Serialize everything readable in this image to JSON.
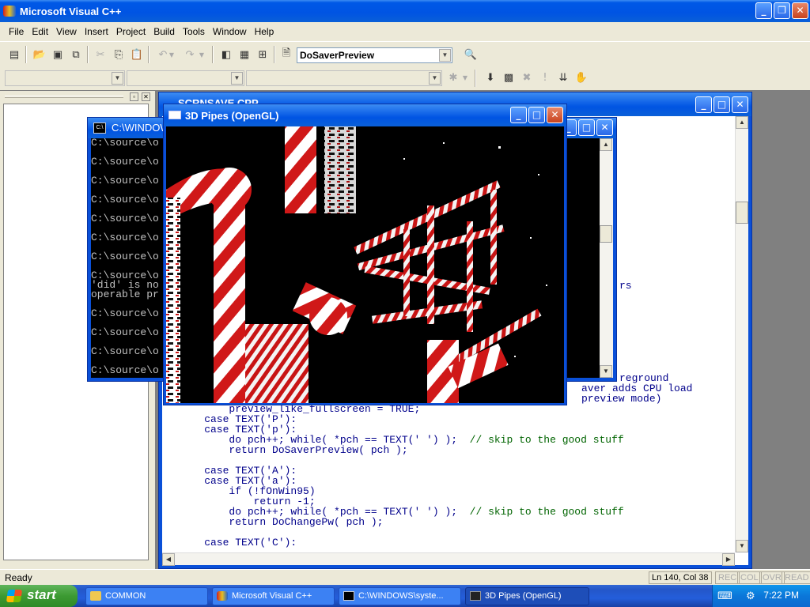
{
  "app": {
    "title": "Microsoft Visual C++",
    "menu": [
      "File",
      "Edit",
      "View",
      "Insert",
      "Project",
      "Build",
      "Tools",
      "Window",
      "Help"
    ],
    "toolbar": {
      "find_combo_value": "DoSaverPreview"
    }
  },
  "console_window": {
    "title": "C:\\WINDOW",
    "lines": [
      "C:\\source\\o",
      "",
      "C:\\source\\o",
      "",
      "C:\\source\\o",
      "",
      "C:\\source\\o",
      "",
      "C:\\source\\o",
      "",
      "C:\\source\\o",
      "",
      "C:\\source\\o",
      "",
      "C:\\source\\o",
      "'did' is no",
      "operable pr",
      "",
      "C:\\source\\o",
      "",
      "C:\\source\\o",
      "",
      "C:\\source\\o",
      "",
      "C:\\source\\o"
    ]
  },
  "pipes_window": {
    "title": "3D Pipes (OpenGL)"
  },
  "editor": {
    "title": "SCRNSAVE.CPP",
    "right_fragments": [
      "rs",
      "reground",
      "aver adds CPU load",
      "preview mode)"
    ],
    "code": [
      {
        "text": "        preview_like_fullscreen = TRUE;",
        "comment": ""
      },
      {
        "text": "    case TEXT('P'):",
        "comment": ""
      },
      {
        "text": "    case TEXT('p'):",
        "comment": ""
      },
      {
        "text": "        do pch++; while( *pch == TEXT(' ') );  ",
        "comment": "// skip to the good stuff"
      },
      {
        "text": "        return DoSaverPreview( pch );",
        "comment": ""
      },
      {
        "text": "",
        "comment": ""
      },
      {
        "text": "    case TEXT('A'):",
        "comment": ""
      },
      {
        "text": "    case TEXT('a'):",
        "comment": ""
      },
      {
        "text": "        if (!fOnWin95)",
        "comment": ""
      },
      {
        "text": "            return -1;",
        "comment": ""
      },
      {
        "text": "        do pch++; while( *pch == TEXT(' ') );  ",
        "comment": "// skip to the good stuff"
      },
      {
        "text": "        return DoChangePw( pch );",
        "comment": ""
      },
      {
        "text": "",
        "comment": ""
      },
      {
        "text": "    case TEXT('C'):",
        "comment": ""
      }
    ]
  },
  "statusbar": {
    "text": "Ready",
    "position": "Ln 140, Col 38",
    "indicators": [
      "REC",
      "COL",
      "OVR",
      "READ"
    ]
  },
  "taskbar": {
    "start": "start",
    "tasks": [
      {
        "label": "COMMON",
        "active": false
      },
      {
        "label": "Microsoft Visual C++",
        "active": false
      },
      {
        "label": "C:\\WINDOWS\\syste...",
        "active": false
      },
      {
        "label": "3D Pipes (OpenGL)",
        "active": true
      }
    ],
    "clock": "7:22 PM"
  },
  "colors": {
    "titlebar": "#0054e3",
    "taskbar": "#245edb",
    "start": "#3c9a32",
    "pipe_red": "#d01818",
    "pipe_white": "#ffffff",
    "code_keyword": "#00008b",
    "code_comment": "#006400"
  }
}
